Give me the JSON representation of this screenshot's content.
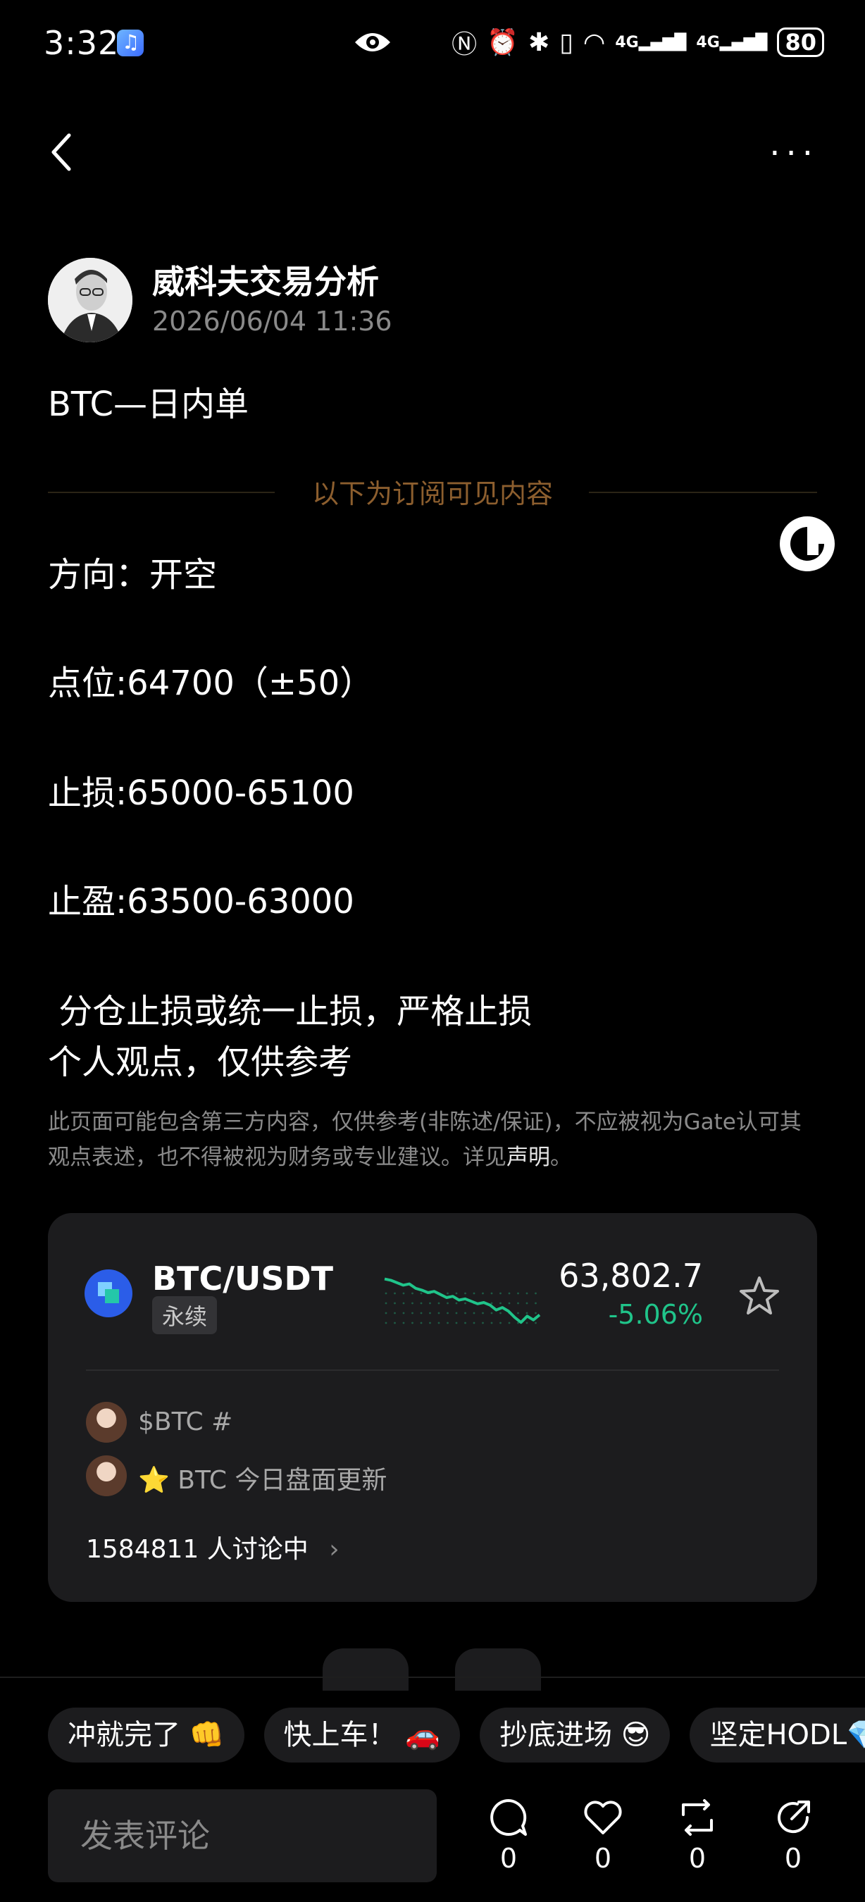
{
  "status_bar": {
    "time": "3:32",
    "network_1": "4G",
    "network_2": "4G",
    "battery": "80"
  },
  "author": {
    "name": "威科夫交易分析",
    "time": "2026/06/04 11:36"
  },
  "post": {
    "title": "BTC—日内单",
    "subscription_divider": "以下为订阅可见内容",
    "lines": [
      "方向：开空",
      "点位:64700（±50）",
      "止损:65000-65100",
      "止盈:63500-63000",
      " 分仓止损或统一止损，严格止损",
      "个人观点，仅供参考"
    ]
  },
  "disclaimer": {
    "text": "此页面可能包含第三方内容，仅供参考(非陈述/保证)，不应被视为Gate认可其观点表述，也不得被视为财务或专业建议。详见",
    "link": "声明",
    "end": "。"
  },
  "market_card": {
    "pair": "BTC/USDT",
    "tag": "永续",
    "price": "63,802.7",
    "change": "-5.06%",
    "feed": [
      {
        "text": "$BTC #"
      },
      {
        "text": "⭐ BTC 今日盘面更新"
      }
    ],
    "discussion": "1584811 人讨论中",
    "sparkline": [
      0.8,
      0.78,
      0.74,
      0.7,
      0.72,
      0.65,
      0.62,
      0.58,
      0.6,
      0.55,
      0.5,
      0.52,
      0.46,
      0.48,
      0.44,
      0.4,
      0.42,
      0.38,
      0.3,
      0.34,
      0.28,
      0.18,
      0.1,
      0.2,
      0.14,
      0.22
    ],
    "colors": {
      "positive_change": "#20c48a"
    }
  },
  "quick_replies": [
    "冲就完了 👊",
    "快上车！ 🚗",
    "抄底进场 😎",
    "坚定HODL💎"
  ],
  "comment": {
    "placeholder": "发表评论"
  },
  "actions": [
    {
      "icon": "comment-icon",
      "count": "0"
    },
    {
      "icon": "like-icon",
      "count": "0"
    },
    {
      "icon": "repost-icon",
      "count": "0"
    },
    {
      "icon": "share-icon",
      "count": "0"
    }
  ]
}
